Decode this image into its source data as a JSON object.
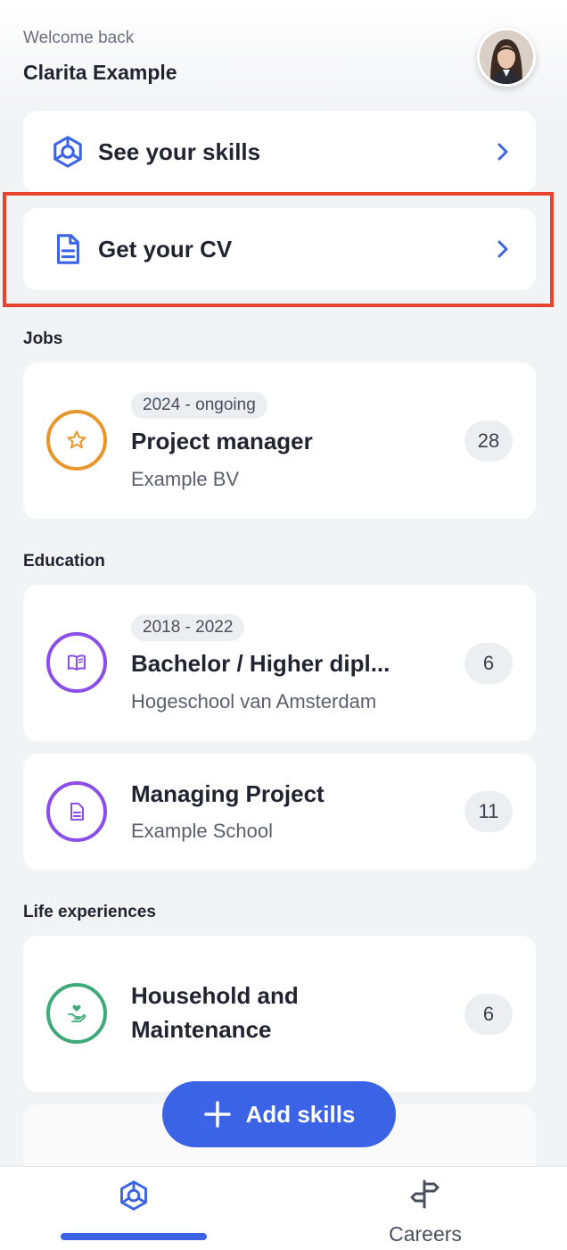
{
  "header": {
    "welcome": "Welcome back",
    "user_name": "Clarita Example"
  },
  "actions": {
    "see_skills": "See your skills",
    "get_cv": "Get your CV"
  },
  "sections": {
    "jobs": "Jobs",
    "education": "Education",
    "life": "Life experiences"
  },
  "jobs": [
    {
      "period": "2024 - ongoing",
      "title": "Project manager",
      "subtitle": "Example BV",
      "count": "28",
      "icon": "star-icon"
    }
  ],
  "education": [
    {
      "period": "2018 - 2022",
      "title": "Bachelor / Higher dipl...",
      "subtitle": "Hogeschool van Amsterdam",
      "count": "6",
      "icon": "book-icon"
    },
    {
      "title": "Managing Project",
      "subtitle": "Example School",
      "count": "11",
      "icon": "document-icon"
    }
  ],
  "life": [
    {
      "title_line1": "Household and",
      "title_line2": "Maintenance",
      "count": "6",
      "icon": "heart-hand-icon"
    }
  ],
  "add_button": "Add skills",
  "nav": {
    "careers": "Careers"
  },
  "colors": {
    "accent": "#3a63e6",
    "job_ring": "#e8962e",
    "education_ring": "#8b4fe8",
    "life_ring": "#3fa97a",
    "highlight": "#e8432d"
  }
}
